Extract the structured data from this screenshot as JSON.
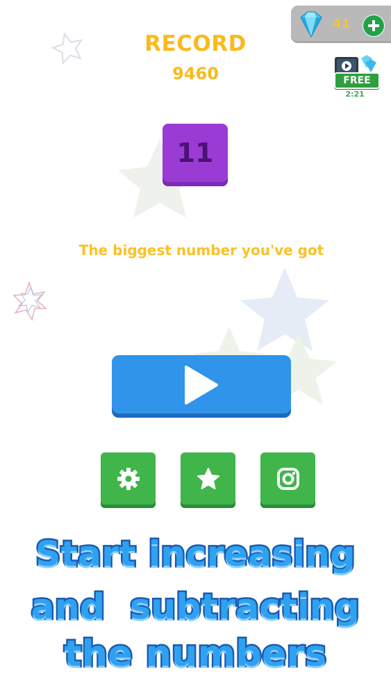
{
  "currency": {
    "gem_count": "41",
    "icon": "diamond-icon",
    "add_icon": "plus-icon",
    "accent_color": "#f4c53b"
  },
  "free_reward": {
    "label": "FREE",
    "timer": "2:21",
    "icon": "video-reward-icon"
  },
  "record": {
    "title": "RECORD",
    "value": "9460"
  },
  "biggest_number": {
    "value": "11",
    "caption": "The biggest number you've got",
    "tile_color": "#9a3bd6"
  },
  "play_button": {
    "icon": "play-icon",
    "color": "#2f94ea"
  },
  "bottom_buttons": [
    {
      "name": "settings-button",
      "icon": "gear-icon"
    },
    {
      "name": "rate-button",
      "icon": "star-icon"
    },
    {
      "name": "instagram-button",
      "icon": "camera-icon"
    }
  ],
  "promo": {
    "line1": "Start increasing",
    "line2": "and  subtracting",
    "line3": "the numbers",
    "color": "#2fa1f1"
  }
}
